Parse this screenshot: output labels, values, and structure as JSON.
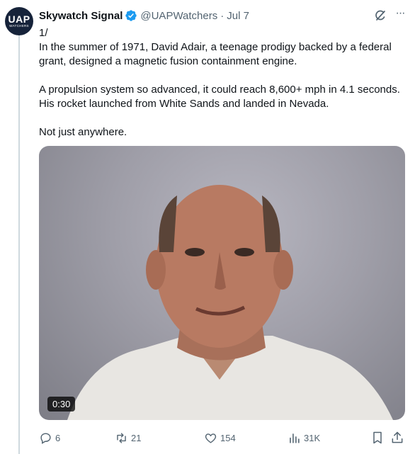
{
  "author": {
    "avatar_line1": "UAP",
    "avatar_line2": "WATCHERS",
    "name": "Skywatch Signal",
    "handle": "@UAPWatchers",
    "separator": "·",
    "date": "Jul 7"
  },
  "tweet": {
    "paragraphs": [
      "1/\nIn the summer of 1971, David Adair, a teenage prodigy backed by a federal grant, designed a magnetic fusion containment engine.",
      "A propulsion system so advanced, it could reach 8,600+ mph in 4.1 seconds. His rocket launched from White Sands and landed in Nevada.",
      "Not just anywhere."
    ]
  },
  "media": {
    "duration": "0:30"
  },
  "actions": {
    "replies": "6",
    "retweets": "21",
    "likes": "154",
    "views": "31K"
  },
  "icons": [
    "verified-badge-icon",
    "grok-icon",
    "more-icon",
    "reply-icon",
    "retweet-icon",
    "like-icon",
    "views-icon",
    "bookmark-icon",
    "share-icon"
  ],
  "colors": {
    "verified": "#1d9bf0",
    "secondary_text": "#536471",
    "avatar_bg": "#16233a"
  }
}
